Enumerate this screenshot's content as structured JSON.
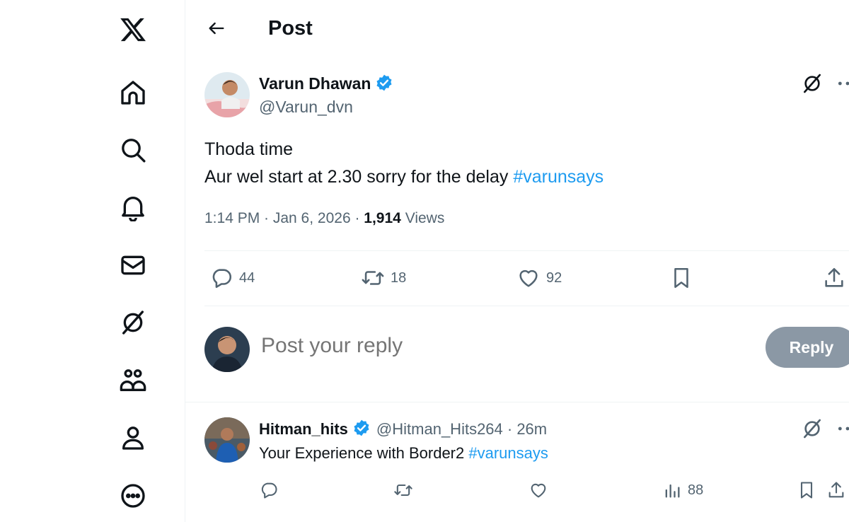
{
  "header": {
    "title": "Post"
  },
  "sidebar": {
    "items": [
      {
        "name": "x-logo-icon"
      },
      {
        "name": "home-icon"
      },
      {
        "name": "search-icon"
      },
      {
        "name": "notifications-icon"
      },
      {
        "name": "messages-icon"
      },
      {
        "name": "grok-icon"
      },
      {
        "name": "communities-icon"
      },
      {
        "name": "profile-icon"
      },
      {
        "name": "more-icon"
      }
    ]
  },
  "post": {
    "author_name": "Varun Dhawan",
    "author_handle": "@Varun_dvn",
    "text_line1": "Thoda time",
    "text_line2": "Aur wel start at 2.30 sorry for the delay ",
    "hashtag": "#varunsays",
    "time": "1:14 PM · Jan 6, 2026 · ",
    "views_count": "1,914",
    "views_label": " Views",
    "replies": "44",
    "reposts": "18",
    "likes": "92"
  },
  "composer": {
    "placeholder": "Post your reply",
    "button_label": "Reply"
  },
  "reply": {
    "author_name": "Hitman_hits",
    "author_handle": "@Hitman_Hits264 · 26m",
    "text": "Your Experience with Border2 ",
    "hashtag": "#varunsays",
    "views": "88"
  },
  "colors": {
    "accent": "#1d9bf0",
    "text": "#0f1419",
    "secondary": "#536471",
    "reply_button": "#8b98a5"
  }
}
